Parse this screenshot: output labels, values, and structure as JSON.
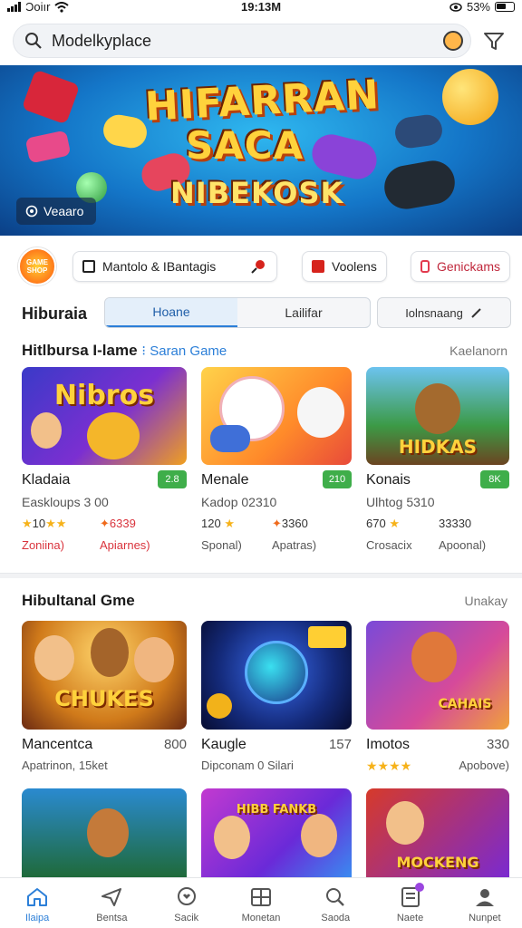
{
  "status_bar": {
    "carrier": "Ɔoiır",
    "time": "19:13M",
    "battery": "53%"
  },
  "search": {
    "query": "Modelkyplace"
  },
  "banner": {
    "line1": "HIFARRAN",
    "line2": "SACA",
    "line3": "NIBEKOSK",
    "chip_label": "Veaaro"
  },
  "quick_actions": [
    {
      "label": "Mantolo & IBantagis"
    },
    {
      "label": "Voolens"
    },
    {
      "label": "Genickams"
    }
  ],
  "categories": {
    "title": "Hiburaia",
    "tabs": [
      {
        "label": "Hoane",
        "active": true
      },
      {
        "label": "Lailifar",
        "active": false
      }
    ],
    "more_label": "Iolnsnaang"
  },
  "section1": {
    "title": "Hitlbursa I-lame",
    "accent": "Saran Game",
    "link": "Kaelanorn",
    "cards": [
      {
        "thumb_text": "Nibros",
        "name": "Kladaia",
        "badge": "2.8",
        "sub": "Easkloups 3 00",
        "rating": "10",
        "count": "6339",
        "left_label": "Zoniina)",
        "right_label": "Apiarnes)"
      },
      {
        "thumb_text": "",
        "name": "Menale",
        "badge": "210",
        "sub": "Kadop 02310",
        "rating": "120",
        "count": "3360",
        "left_label": "Sponal)",
        "right_label": "Apatras)"
      },
      {
        "thumb_text": "HIDKAS",
        "name": "Konais",
        "badge": "8K",
        "sub": "Ulhtog 5310",
        "rating": "670",
        "count": "33330",
        "left_label": "Crosacix",
        "right_label": "Apoonal)"
      }
    ]
  },
  "section2": {
    "title": "Hibultanal Gme",
    "link": "Unakay",
    "cards": [
      {
        "thumb_text": "CHUKES",
        "name": "Mancentca",
        "num": "800",
        "sub": "Apatrinon, 15ket",
        "stars": "",
        "sub2": ""
      },
      {
        "thumb_text": "",
        "name": "Kaugle",
        "num": "157",
        "sub": "Dipconam 0 Silari",
        "stars": "",
        "sub2": ""
      },
      {
        "thumb_text": "CAHAIS",
        "name": "Imotos",
        "num": "330",
        "sub": "",
        "stars": "★★★★",
        "sub2": "Apobove)"
      }
    ],
    "row2_texts": [
      "",
      "HIBB FANKB",
      "MOCKENG"
    ]
  },
  "nav": [
    {
      "label": "Ilaipa",
      "icon": "home-icon",
      "active": true
    },
    {
      "label": "Bentsa",
      "icon": "send-icon",
      "active": false
    },
    {
      "label": "Sacik",
      "icon": "chat-heart-icon",
      "active": false
    },
    {
      "label": "Monetan",
      "icon": "grid-icon",
      "active": false
    },
    {
      "label": "Saoda",
      "icon": "search-icon",
      "active": false
    },
    {
      "label": "Naete",
      "icon": "note-icon",
      "active": false
    },
    {
      "label": "Nunpet",
      "icon": "profile-icon",
      "active": false
    }
  ],
  "colors": {
    "accent": "#2c7fd8",
    "badge_green": "#3fae4a",
    "star": "#f6b21a",
    "danger": "#d9333c"
  }
}
